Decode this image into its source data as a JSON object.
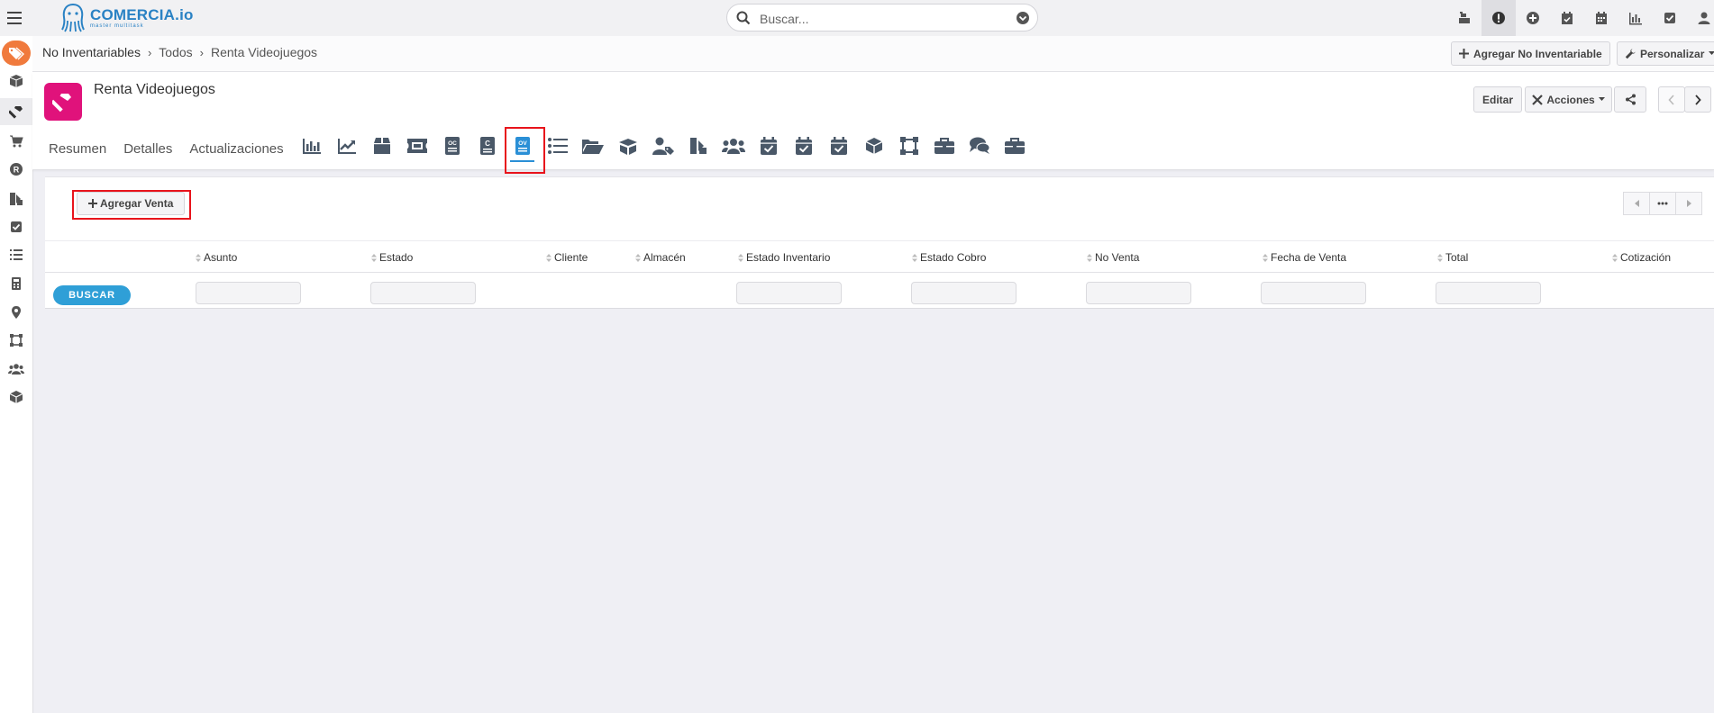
{
  "app": {
    "logo_text": "COMERCIA.io",
    "logo_tagline": "master multitask"
  },
  "search": {
    "placeholder": "Buscar..."
  },
  "top_icons": [
    "cash-register-icon",
    "alert-icon",
    "plus-circle-icon",
    "calendar-check-icon",
    "calendar-icon",
    "bar-chart-icon",
    "check-square-icon",
    "user-icon"
  ],
  "sidebar": {
    "items": [
      "box-icon",
      "hammer-icon",
      "cart-icon",
      "registered-icon",
      "tags-icon",
      "check-square-icon",
      "list-icon",
      "calculator-icon",
      "map-marker-icon",
      "vector-square-icon",
      "users-icon",
      "cube-icon"
    ]
  },
  "breadcrumb": {
    "items": [
      "No Inventariables",
      "Todos",
      "Renta Videojuegos"
    ]
  },
  "breadbar_buttons": {
    "add": "Agregar No Inventariable",
    "customize": "Personalizar"
  },
  "record": {
    "title": "Renta Videojuegos",
    "edit_label": "Editar",
    "actions_label": "Acciones"
  },
  "tabs": [
    "Resumen",
    "Detalles",
    "Actualizaciones"
  ],
  "tab_icons": [
    "bar-chart-icon",
    "line-chart-icon",
    "box-icon",
    "ticket-icon",
    "oc-document-icon",
    "c-document-icon",
    "ov-document-icon",
    "list-icon",
    "folder-open-icon",
    "box-open-icon",
    "user-tag-icon",
    "tags-icon",
    "users-icon",
    "calendar-check-icon",
    "calendar-check-icon",
    "calendar-check-icon",
    "cube-icon",
    "vector-square-icon",
    "briefcase-icon",
    "comments-icon",
    "briefcase-icon"
  ],
  "active_tab_icon": "ov-document-icon",
  "panel": {
    "add_button": "Agregar Venta",
    "search_button": "BUSCAR",
    "columns": [
      "Asunto",
      "Estado",
      "Cliente",
      "Almacén",
      "Estado Inventario",
      "Estado Cobro",
      "No Venta",
      "Fecha de Venta",
      "Total",
      "Cotización"
    ]
  },
  "colors": {
    "accent_blue": "#2f9fd7",
    "record_icon": "#e0127b",
    "brand_tag": "#f07a3d",
    "highlight_red": "#e8141c"
  }
}
